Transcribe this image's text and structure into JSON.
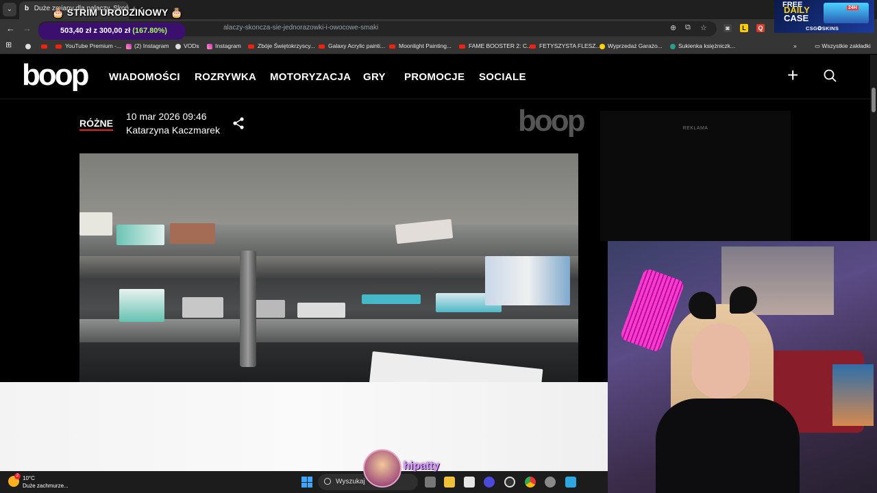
{
  "browser": {
    "tab_title": "Duże zmiany dla palaczy. Skończ...",
    "url": "alaczy-skoncza-sie-jednorazowki-i-owocowe-smaki",
    "bookmarks": [
      "YouTube Premium -...",
      "(2) Instagram",
      "VODs",
      "Instagram",
      "Zbóje Świętokrzyscy...",
      "Galaxy Acrylic painti...",
      "Moonlight Painting...",
      "FAME BOOSTER 2: C...",
      "FETYSZYSTA FLESZ...",
      "Wyprzedaż Garażo...",
      "Sukienka księżniczk..."
    ],
    "all_bookmarks": "Wszystkie zakładki"
  },
  "stream": {
    "title": "🎂 STRIM URODZIŃOWY 🎂",
    "donation_raised": "503,40 zł z 300,00 zł",
    "donation_pct": "(167.80%)",
    "promo_line1": "FREE",
    "promo_line2": "DAILY",
    "promo_line3": "CASE",
    "promo_brand": "CSG✪SKINS",
    "promo_badge": "24H",
    "streamer_name": "hipatty"
  },
  "site": {
    "logo": "boop",
    "menu": [
      "WIADOMOŚCI",
      "ROZRYWKA",
      "MOTORYZACJA",
      "GRY",
      "PROMOCJE",
      "SOCIALE"
    ],
    "ad_label": "REKLAMA"
  },
  "article": {
    "category": "RÓŻNE",
    "date": "10 mar 2026 09:46",
    "author": "Katarzyna Kaczmarek"
  },
  "taskbar": {
    "temperature": "10°C",
    "weather": "Duże zachmurze...",
    "weather_badge": "2",
    "search_label": "Wyszukaj"
  },
  "colors": {
    "accent_red": "#e8202a",
    "donation_bg": "#3b0f6e",
    "donation_pct": "#a6ff5a",
    "streamer_name": "#d6a0ff"
  }
}
